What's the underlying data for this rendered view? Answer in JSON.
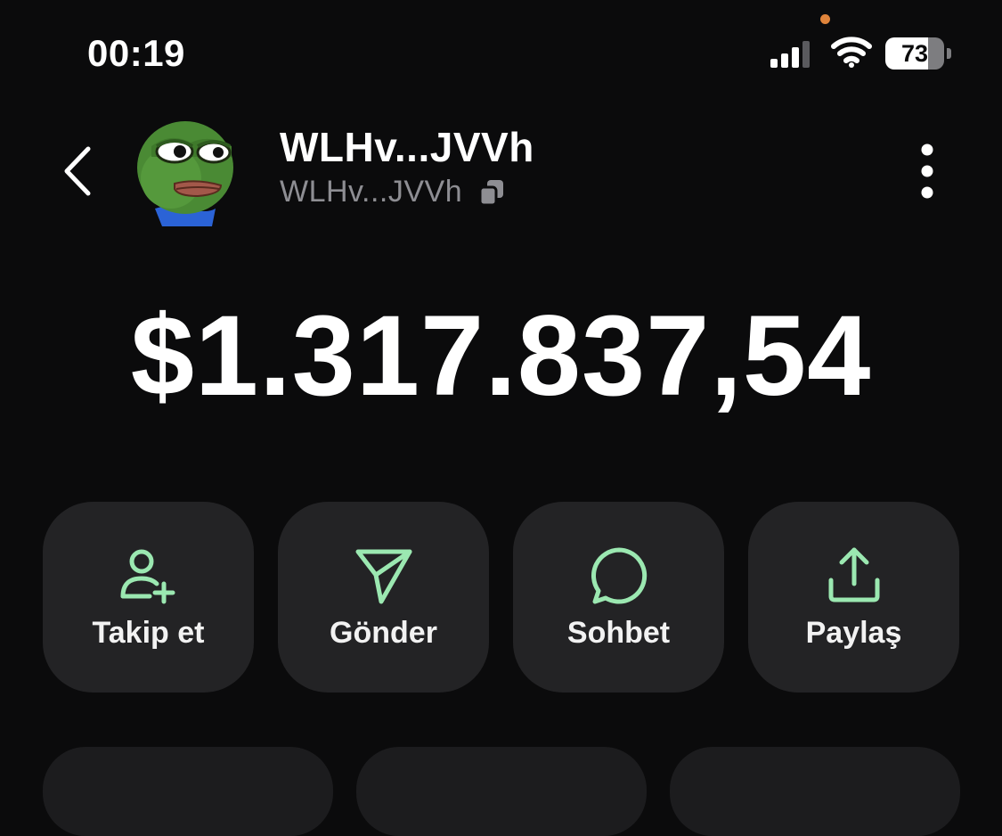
{
  "status_bar": {
    "time": "00:19",
    "battery_level": "73",
    "icons": [
      "cellular-signal-icon",
      "wifi-icon",
      "battery-icon"
    ]
  },
  "header": {
    "display_name": "WLHv...JVVh",
    "address": "WLHv...JVVh",
    "icons": [
      "back-chevron-icon",
      "avatar-frog",
      "copy-icon",
      "more-vertical-icon"
    ]
  },
  "balance": {
    "amount": "$1.317.837,54"
  },
  "actions": [
    {
      "label": "Takip et",
      "icon": "user-plus-icon"
    },
    {
      "label": "Gönder",
      "icon": "send-icon"
    },
    {
      "label": "Sohbet",
      "icon": "chat-bubble-icon"
    },
    {
      "label": "Paylaş",
      "icon": "share-upload-icon"
    }
  ],
  "colors": {
    "background": "#0b0b0c",
    "card": "#232325",
    "accent": "#9be8b1",
    "muted_text": "#8e8e93",
    "privacy_dot": "#e0843b"
  }
}
